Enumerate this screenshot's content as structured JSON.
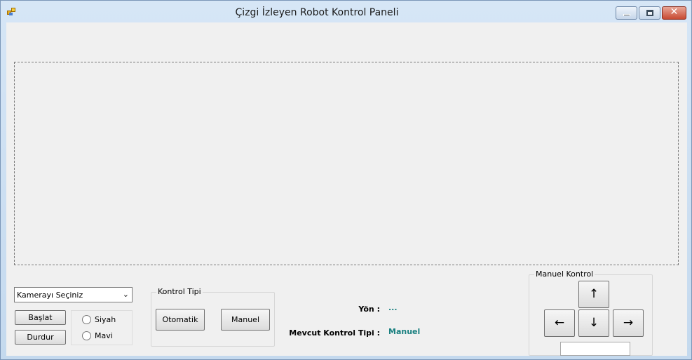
{
  "window": {
    "title": "Çizgi İzleyen Robot Kontrol Paneli",
    "close_glyph": "✕"
  },
  "camera": {
    "select_value": "Kamerayı Seçiniz",
    "select_arrow": "⌄"
  },
  "buttons": {
    "start": "Başlat",
    "stop": "Durdur"
  },
  "color_options": [
    {
      "label": "Siyah",
      "checked": false
    },
    {
      "label": "Mavi",
      "checked": false
    }
  ],
  "control_type": {
    "title": "Kontrol Tipi",
    "automatic": "Otomatik",
    "manual": "Manuel"
  },
  "status": {
    "direction_label": "Yön :",
    "direction_value": "...",
    "current_type_label": "Mevcut Kontrol Tipi :",
    "current_type_value": "Manuel",
    "value_color": "#1a8080"
  },
  "manual_control": {
    "title": "Manuel Kontrol",
    "up": "↑",
    "left": "←",
    "down": "↓",
    "right": "→",
    "input_value": ""
  }
}
